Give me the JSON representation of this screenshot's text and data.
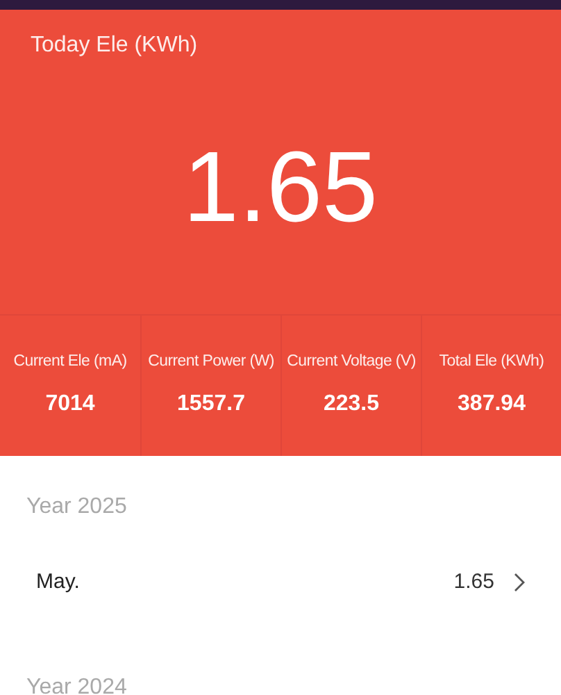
{
  "header": {
    "title": "Today Ele (KWh)",
    "value": "1.65"
  },
  "stats": [
    {
      "label": "Current Ele (mA)",
      "value": "7014"
    },
    {
      "label": "Current Power (W)",
      "value": "1557.7"
    },
    {
      "label": "Current Voltage (V)",
      "value": "223.5"
    },
    {
      "label": "Total Ele (KWh)",
      "value": "387.94"
    }
  ],
  "years": [
    {
      "title": "Year 2025",
      "months": [
        {
          "name": "May.",
          "value": "1.65"
        }
      ]
    },
    {
      "title": "Year 2024"
    }
  ]
}
